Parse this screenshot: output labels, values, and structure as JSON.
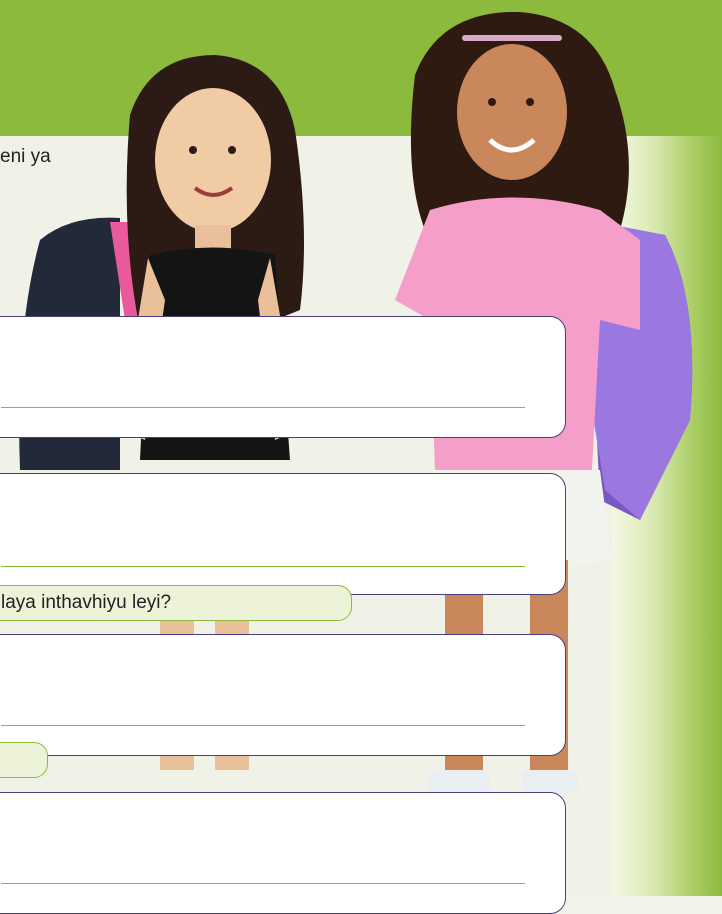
{
  "colors": {
    "brand_green": "#8cba3d",
    "page_background": "#f1f2e7",
    "box_border": "#4a3f7a",
    "answer_line": "#8cba3d"
  },
  "text": {
    "intro_fragment": "eni ya",
    "question_fragment": "laya inthavhiyu leyi?"
  },
  "image": {
    "description_name": "two-schoolgirls-with-backpacks-photo"
  },
  "answer_boxes": [
    {
      "name": "answer-box-1",
      "lines": 1
    },
    {
      "name": "answer-box-2",
      "lines": 1
    },
    {
      "name": "answer-box-3",
      "lines": 1
    },
    {
      "name": "answer-box-4",
      "lines": 1
    }
  ]
}
